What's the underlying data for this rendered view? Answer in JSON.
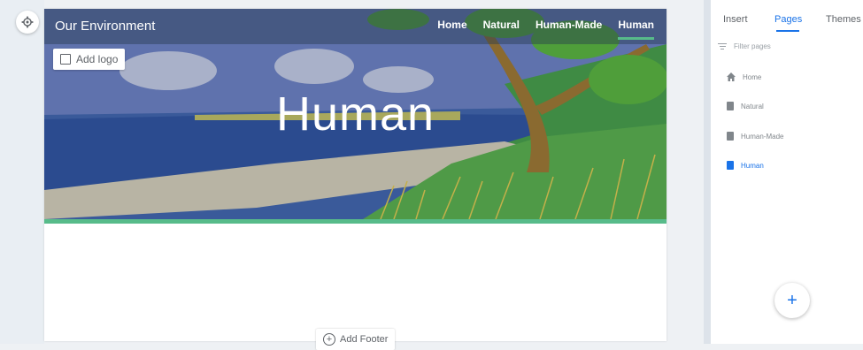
{
  "site": {
    "title": "Our Environment",
    "nav": [
      "Home",
      "Natural",
      "Human-Made",
      "Human"
    ],
    "active_nav": "Human",
    "heading": "Human",
    "add_logo_label": "Add logo",
    "add_footer_label": "Add Footer"
  },
  "sidebar": {
    "tabs": [
      "Insert",
      "Pages",
      "Themes"
    ],
    "active_tab": "Pages",
    "filter_placeholder": "Filter pages",
    "pages": [
      "Home",
      "Natural",
      "Human-Made",
      "Human"
    ],
    "active_page": "Human",
    "add_button_label": "+"
  },
  "icons": {
    "settings": "gear-icon",
    "logo": "image-icon",
    "footer": "add-circle-icon",
    "filter": "filter-icon",
    "home": "home-icon",
    "page": "document-icon"
  },
  "colors": {
    "accent_blue": "#1a73e8",
    "accent_green": "#57bb8a"
  }
}
